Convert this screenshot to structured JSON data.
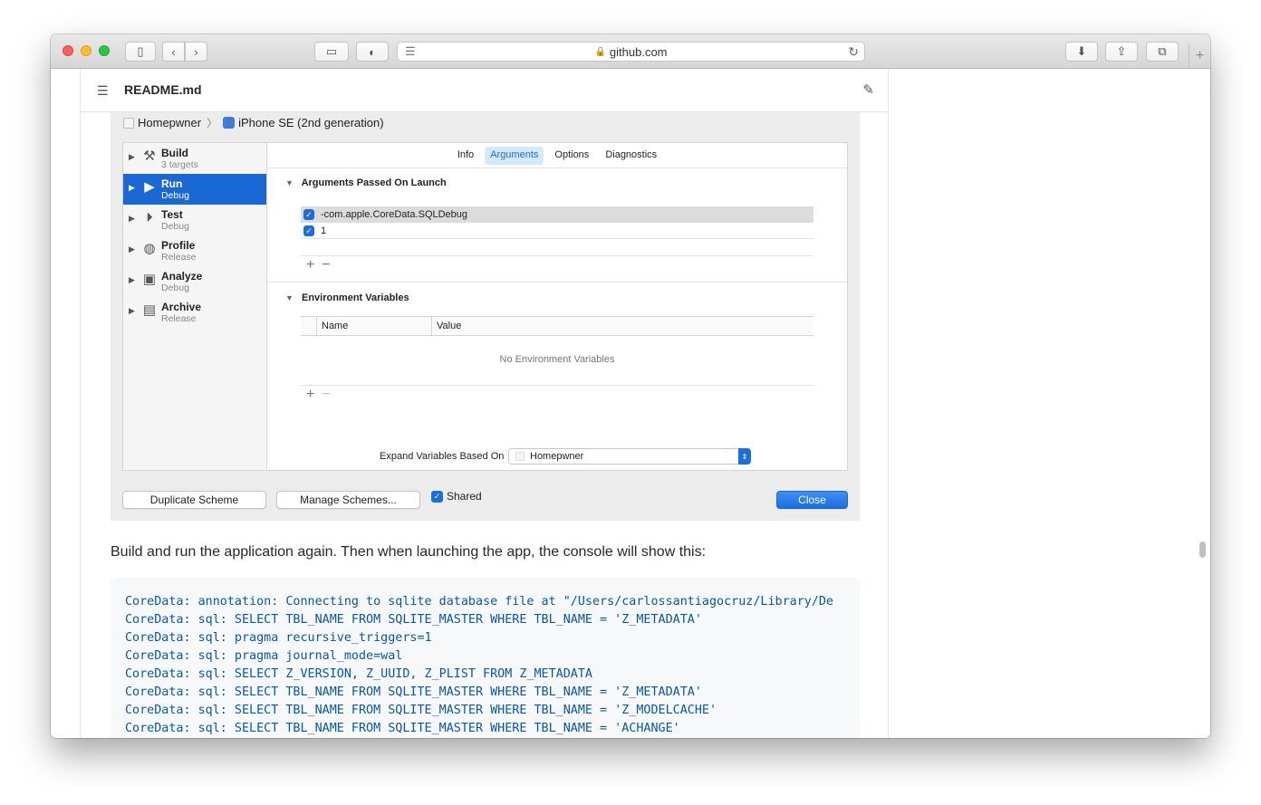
{
  "browser": {
    "url": "github.com",
    "toolbar_icons": [
      "sidebar-icon",
      "back-icon",
      "forward-icon",
      "screen-icon",
      "shield-icon",
      "reader-icon",
      "download-icon",
      "share-icon",
      "tabs-icon",
      "plus-icon"
    ]
  },
  "readme": {
    "filename": "README.md"
  },
  "xcode": {
    "breadcrumb": {
      "scheme": "Homepwner",
      "device": "iPhone SE (2nd generation)"
    },
    "sidebar": [
      {
        "title": "Build",
        "sub": "3 targets",
        "icon": "hammer-icon",
        "selected": false
      },
      {
        "title": "Run",
        "sub": "Debug",
        "icon": "play-icon",
        "selected": true
      },
      {
        "title": "Test",
        "sub": "Debug",
        "icon": "test-icon",
        "selected": false
      },
      {
        "title": "Profile",
        "sub": "Release",
        "icon": "profile-icon",
        "selected": false
      },
      {
        "title": "Analyze",
        "sub": "Debug",
        "icon": "analyze-icon",
        "selected": false
      },
      {
        "title": "Archive",
        "sub": "Release",
        "icon": "archive-icon",
        "selected": false
      }
    ],
    "tabs": [
      "Info",
      "Arguments",
      "Options",
      "Diagnostics"
    ],
    "active_tab": "Arguments",
    "arguments_title": "Arguments Passed On Launch",
    "arguments": [
      "-com.apple.CoreData.SQLDebug",
      "1"
    ],
    "env_title": "Environment Variables",
    "env_columns": [
      "Name",
      "Value"
    ],
    "env_empty": "No Environment Variables",
    "expand_label": "Expand Variables Based On",
    "expand_value": "Homepwner",
    "buttons": {
      "duplicate": "Duplicate Scheme",
      "manage": "Manage Schemes...",
      "shared": "Shared",
      "close": "Close"
    }
  },
  "paragraph": "Build and run the application again. Then when launching the app, the console will show this:",
  "code_lines": [
    "CoreData: annotation: Connecting to sqlite database file at \"/Users/carlossantiagocruz/Library/De",
    "CoreData: sql: SELECT TBL_NAME FROM SQLITE_MASTER WHERE TBL_NAME = 'Z_METADATA'",
    "CoreData: sql: pragma recursive_triggers=1",
    "CoreData: sql: pragma journal_mode=wal",
    "CoreData: sql: SELECT Z_VERSION, Z_UUID, Z_PLIST FROM Z_METADATA",
    "CoreData: sql: SELECT TBL_NAME FROM SQLITE_MASTER WHERE TBL_NAME = 'Z_METADATA'",
    "CoreData: sql: SELECT TBL_NAME FROM SQLITE_MASTER WHERE TBL_NAME = 'Z_MODELCACHE'",
    "CoreData: sql: SELECT TBL_NAME FROM SQLITE_MASTER WHERE TBL_NAME = 'ACHANGE'"
  ]
}
